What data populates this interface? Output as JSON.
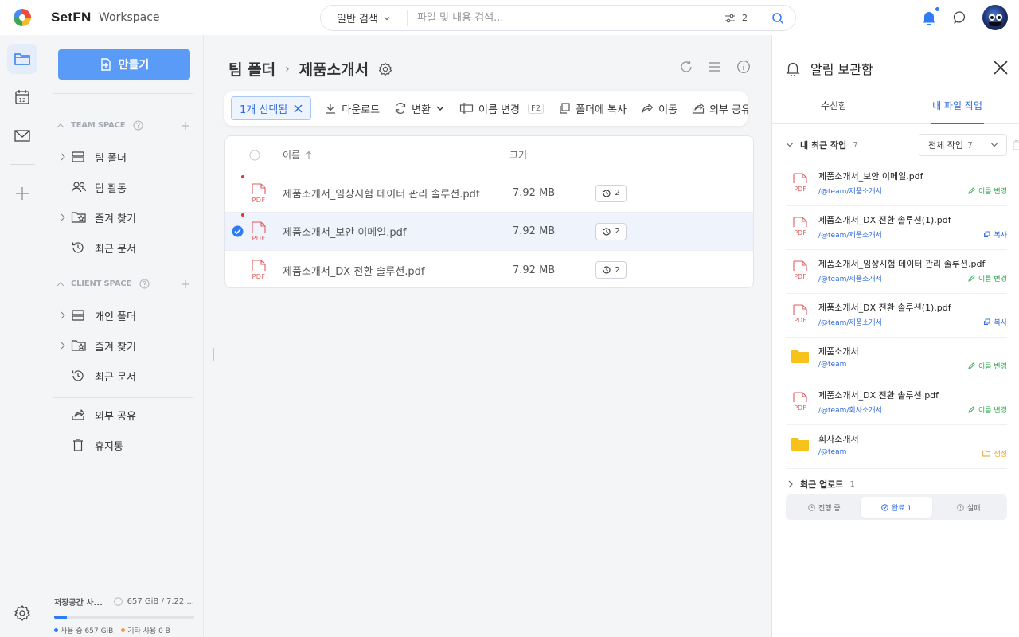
{
  "header": {
    "brand": "SetFN",
    "workspace": "Workspace",
    "search_type": "일반 검색",
    "search_placeholder": "파일 및 내용 검색...",
    "filter_count": "2",
    "colors": {
      "accent": "#2f7bf5",
      "primary_button": "#5b9bf8"
    }
  },
  "rail": {
    "icons": [
      "folder-icon",
      "calendar-icon",
      "mail-icon",
      "plus-icon",
      "settings-icon"
    ],
    "calendar_day": "12"
  },
  "sidebar": {
    "make_button": "만들기",
    "team_space": {
      "title": "TEAM SPACE",
      "items": [
        {
          "label": "팀 폴더",
          "icon": "storage-icon"
        },
        {
          "label": "팀 활동",
          "icon": "people-icon"
        },
        {
          "label": "즐겨 찾기",
          "icon": "star-folder-icon"
        },
        {
          "label": "최근 문서",
          "icon": "history-icon"
        }
      ]
    },
    "client_space": {
      "title": "CLIENT SPACE",
      "items": [
        {
          "label": "개인 폴더",
          "icon": "storage-icon"
        },
        {
          "label": "즐겨 찾기",
          "icon": "star-folder-icon"
        },
        {
          "label": "최근 문서",
          "icon": "history-icon"
        }
      ]
    },
    "bottom_items": [
      {
        "label": "외부 공유",
        "icon": "share-icon"
      },
      {
        "label": "휴지통",
        "icon": "trash-icon"
      }
    ],
    "storage": {
      "label": "저장공간 사...",
      "value": "657 GiB / 7.22 ...",
      "used_fraction": 0.09,
      "used_label": "사용 중 657 GiB",
      "other_label": "기타 사용 0 B"
    }
  },
  "main": {
    "breadcrumb": [
      "팀 폴더",
      "제품소개서"
    ],
    "actions": {
      "selected": "1개 선택됨",
      "download": "다운로드",
      "convert": "변환",
      "rename": "이름 변경",
      "rename_key": "F2",
      "copy": "폴더에 복사",
      "move": "이동",
      "share": "외부 공유"
    },
    "table": {
      "col_name": "이름",
      "col_size": "크기",
      "rows": [
        {
          "name": "제품소개서_임상시험 데이터 관리 솔루션.pdf",
          "size": "7.92 MB",
          "versions": "2",
          "selected": false
        },
        {
          "name": "제품소개서_보안 이메일.pdf",
          "size": "7.92 MB",
          "versions": "2",
          "selected": true
        },
        {
          "name": "제품소개서_DX 전환 솔루션.pdf",
          "size": "7.92 MB",
          "versions": "2",
          "selected": false
        }
      ]
    }
  },
  "panel": {
    "title": "알림 보관함",
    "tabs": [
      "수신함",
      "내 파일 작업"
    ],
    "recent": {
      "title": "내 최근 작업",
      "count": "7",
      "filter_label": "전체 작업",
      "filter_count": "7",
      "items": [
        {
          "name": "제품소개서_보안 이메일.pdf",
          "path": "/@team/제품소개서",
          "status": "이름 변경",
          "type": "pdf"
        },
        {
          "name": "제품소개서_DX 전환 솔루션(1).pdf",
          "path": "/@team/제품소개서",
          "status": "복사",
          "type": "pdf"
        },
        {
          "name": "제품소개서_임상시험 데이터 관리 솔루션.pdf",
          "path": "/@team/제품소개서",
          "status": "이름 변경",
          "type": "pdf"
        },
        {
          "name": "제품소개서_DX 전환 솔루션(1).pdf",
          "path": "/@team/제품소개서",
          "status": "복사",
          "type": "pdf"
        },
        {
          "name": "제품소개서",
          "path": "/@team",
          "status": "이름 변경",
          "type": "folder"
        },
        {
          "name": "제품소개서_DX 전환 솔루션.pdf",
          "path": "/@team/회사소개서",
          "status": "이름 변경",
          "type": "pdf"
        },
        {
          "name": "회사소개서",
          "path": "/@team",
          "status": "생성",
          "type": "folder"
        }
      ]
    },
    "upload": {
      "title": "최근 업로드",
      "count": "1",
      "tabs": [
        "진행 중",
        "완료 1",
        "실패"
      ]
    }
  }
}
